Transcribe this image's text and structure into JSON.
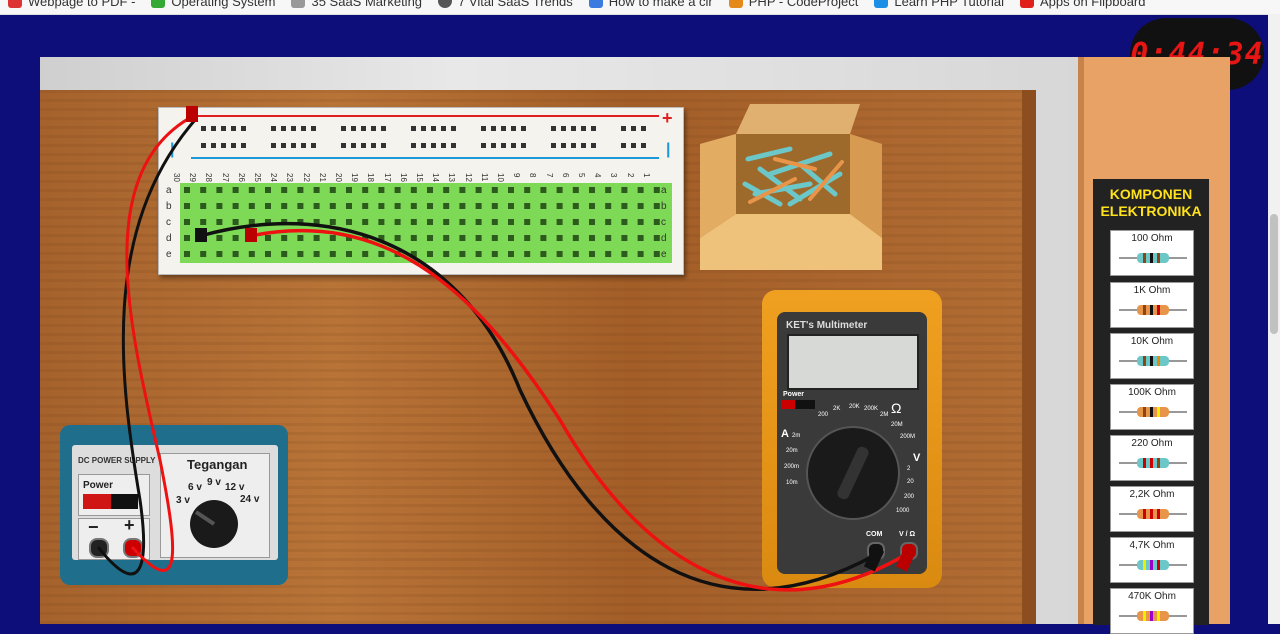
{
  "bookmarks": [
    {
      "label": "Webpage to PDF -",
      "color": "#d33"
    },
    {
      "label": "Operating System",
      "color": "#3a3"
    },
    {
      "label": "35 SaaS Marketing",
      "color": "#999"
    },
    {
      "label": "7 Vital SaaS Trends",
      "color": "#555"
    },
    {
      "label": "How to make a cir",
      "color": "#3b7be0"
    },
    {
      "label": "PHP - CodeProject",
      "color": "#e58a1a"
    },
    {
      "label": "Learn PHP Tutorial",
      "color": "#1a8fe5"
    },
    {
      "label": "Apps on Flipboard",
      "color": "#e0201b"
    }
  ],
  "timer": "0:44:34",
  "panel": {
    "title_line1": "KOMPONEN",
    "title_line2": "ELEKTRONIKA",
    "components": [
      {
        "label": "100 Ohm",
        "color": "#6cc7c8"
      },
      {
        "label": "1K Ohm",
        "color": "#e8954a"
      },
      {
        "label": "10K Ohm",
        "color": "#6cc7c8"
      },
      {
        "label": "100K Ohm",
        "color": "#e8954a"
      },
      {
        "label": "220 Ohm",
        "color": "#6cc7c8"
      },
      {
        "label": "2,2K Ohm",
        "color": "#e8954a"
      },
      {
        "label": "4,7K Ohm",
        "color": "#6cc7c8"
      },
      {
        "label": "470K Ohm",
        "color": "#e8954a"
      }
    ]
  },
  "breadboard": {
    "plus_sign": "+",
    "minus_sign": "|",
    "columns": [
      "30",
      "29",
      "28",
      "27",
      "26",
      "25",
      "24",
      "23",
      "22",
      "21",
      "20",
      "19",
      "18",
      "17",
      "16",
      "15",
      "14",
      "13",
      "12",
      "11",
      "10",
      "9",
      "8",
      "7",
      "6",
      "5",
      "4",
      "3",
      "2",
      "1"
    ],
    "rows": [
      "a",
      "b",
      "c",
      "d",
      "e"
    ]
  },
  "multimeter": {
    "title": "KET's Multimeter",
    "power_label": "Power",
    "ohm_symbol": "Ω",
    "amp_symbol": "A",
    "volt_symbol": "V",
    "com_label": "COM",
    "vohm_label": "V / Ω",
    "ohm_ranges": [
      "200",
      "2K",
      "20K",
      "200K",
      "2M",
      "20M",
      "200M"
    ],
    "amp_ranges": [
      "2m",
      "20m",
      "200m",
      "10m"
    ],
    "volt_ranges": [
      "2",
      "20",
      "200",
      "1000"
    ]
  },
  "power_supply": {
    "title": "DC POWER SUPPLY",
    "power_label": "Power",
    "tegangan_label": "Tegangan",
    "voltages": [
      "3 v",
      "6 v",
      "9 v",
      "12 v",
      "24 v"
    ],
    "minus": "−",
    "plus": "+"
  }
}
